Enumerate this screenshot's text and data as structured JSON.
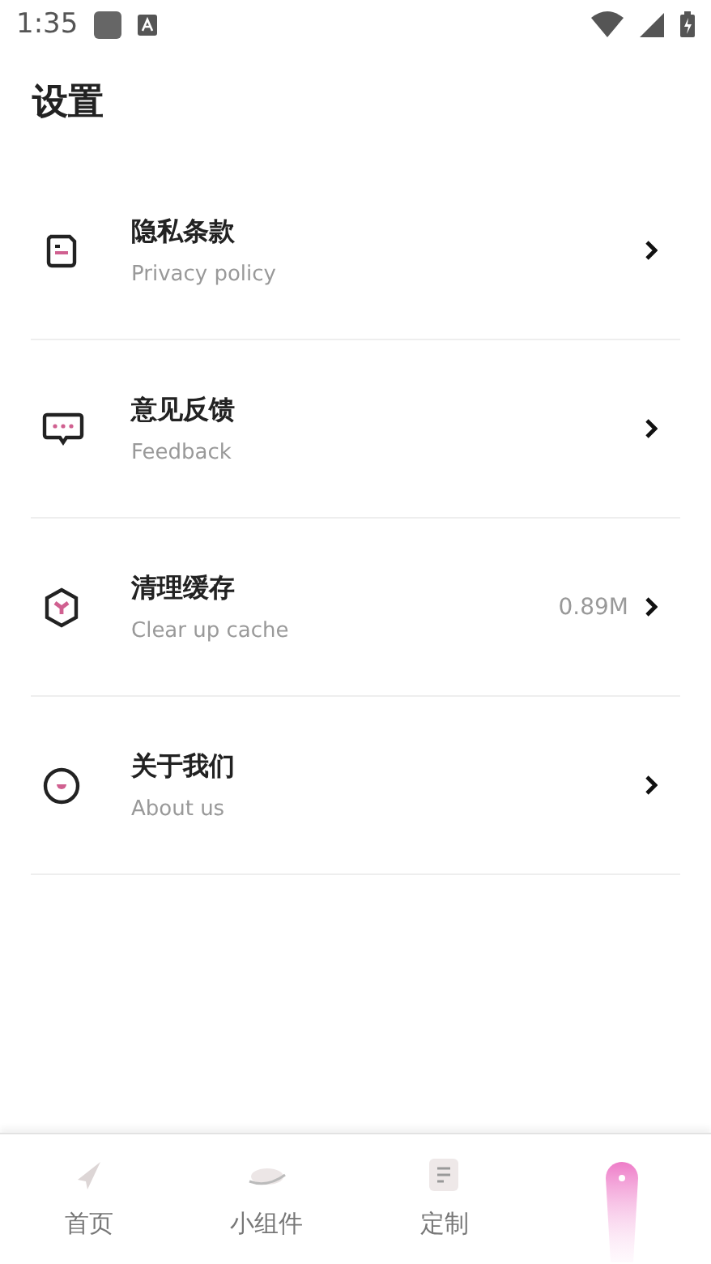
{
  "status_bar": {
    "time": "1:35"
  },
  "title": "设置",
  "items": [
    {
      "title": "隐私条款",
      "subtitle": "Privacy policy"
    },
    {
      "title": "意见反馈",
      "subtitle": "Feedback"
    },
    {
      "title": "清理缓存",
      "subtitle": "Clear up cache",
      "value": "0.89M"
    },
    {
      "title": "关于我们",
      "subtitle": "About us"
    }
  ],
  "tabs": [
    {
      "label": "首页",
      "selected": false
    },
    {
      "label": "小组件",
      "selected": false
    },
    {
      "label": "定制",
      "selected": false
    },
    {
      "selected": true
    }
  ]
}
